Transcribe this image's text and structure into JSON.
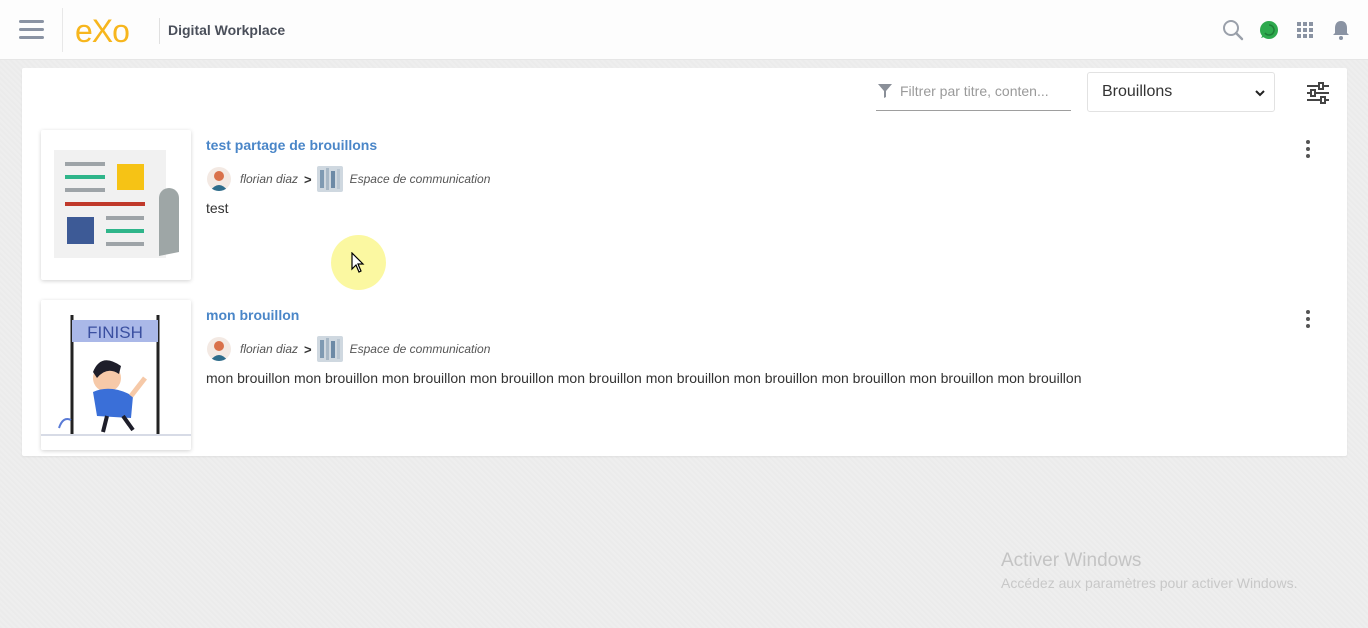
{
  "topbar": {
    "logo_text": "eXo",
    "company_name": "Digital Workplace",
    "icons": [
      "hamburger-icon",
      "search-icon",
      "chat-icon",
      "apps-grid-icon",
      "notification-bell-icon"
    ],
    "colors": {
      "logo": "#f7b61d",
      "chat": "#2eaa4e"
    }
  },
  "toolbar": {
    "filter_placeholder": "Filtrer par titre, conten...",
    "filter_value": "",
    "selected_filter": "Brouillons",
    "filter_options": [
      "Brouillons"
    ]
  },
  "articles": [
    {
      "title": "test partage de brouillons",
      "author": "florian diaz",
      "separator": ">",
      "space": "Espace de communication",
      "summary": "test",
      "thumbnail": "newspaper-illustration"
    },
    {
      "title": "mon brouillon",
      "author": "florian diaz",
      "separator": ">",
      "space": "Espace de communication",
      "summary": "mon brouillon mon brouillon mon brouillon mon brouillon mon brouillon mon brouillon mon brouillon mon brouillon mon brouillon mon brouillon",
      "thumbnail": "finish-line-illustration",
      "thumbnail_text": "FINISH"
    }
  ],
  "watermark": {
    "title": "Activer Windows",
    "subtitle": "Accédez aux paramètres pour activer Windows."
  },
  "colors": {
    "title_link": "#4a86c8",
    "page_bg": "#eeeeee"
  }
}
